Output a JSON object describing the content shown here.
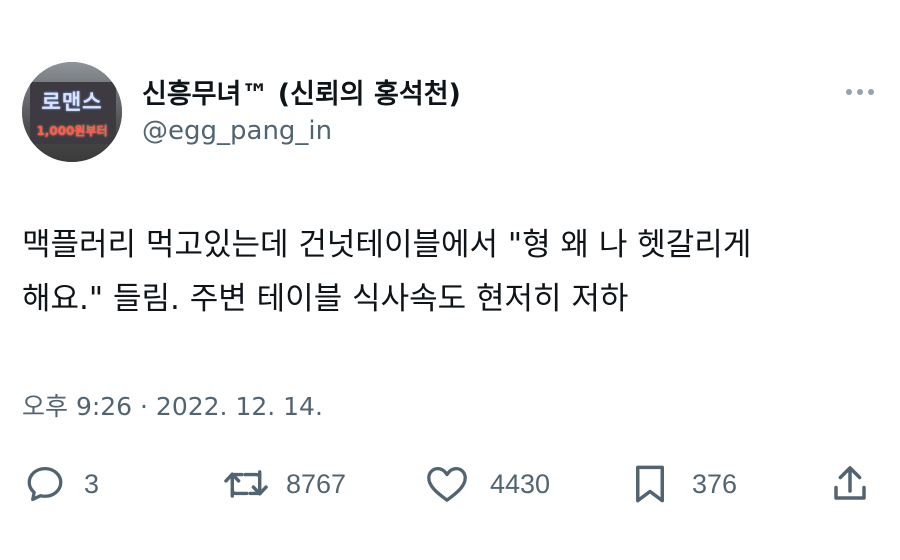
{
  "profile": {
    "display_name": "신흥무녀™ (신뢰의 홍석천)",
    "handle": "@egg_pang_in",
    "avatar_sign_title": "로맨스",
    "avatar_sign_sub": "1,000원부터"
  },
  "tweet": {
    "lines": [
      "맥플러리 먹고있는데 건넛테이블에서 \"형 왜 나 헷갈리게",
      "해요.\" 들림. 주변 테이블 식사속도 현저히 저하"
    ],
    "timestamp": "오후 9:26 · 2022. 12. 14."
  },
  "actions": {
    "replies": "3",
    "retweets": "8767",
    "likes": "4430",
    "bookmarks": "376"
  },
  "icons": {
    "more": "more-dots-icon",
    "reply": "reply-bubble-icon",
    "retweet": "retweet-icon",
    "like": "heart-icon",
    "bookmark": "bookmark-icon",
    "share": "share-upload-icon"
  },
  "colors": {
    "text_primary": "#0f1419",
    "text_secondary": "#536471"
  }
}
